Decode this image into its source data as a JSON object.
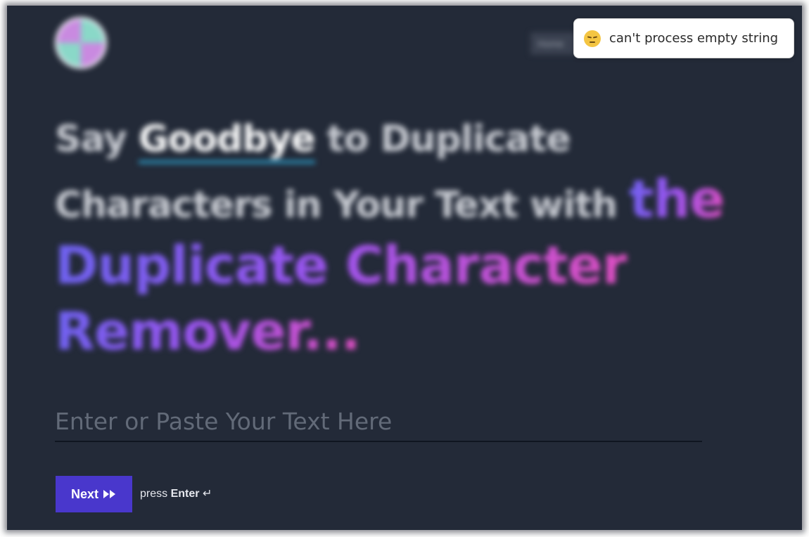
{
  "header": {
    "logo": "app-logo",
    "home_label": "Home"
  },
  "hero": {
    "line1_prefix": "Say ",
    "line1_highlight": "Goodbye",
    "line1_suffix": " to Duplicate",
    "line2": "Characters in Your Text with ",
    "brand_line1": "the",
    "brand_line2": "Duplicate Character",
    "brand_line3": "Remover...",
    "accent_colors": [
      "#6f63f2",
      "#9a55f0",
      "#e04fc2"
    ]
  },
  "form": {
    "input_placeholder": "Enter or Paste Your Text Here",
    "input_value": "",
    "next_label": "Next",
    "next_icon": "fast-forward-icon",
    "hint_prefix": "press ",
    "hint_key": "Enter",
    "hint_icon": "↵"
  },
  "toast": {
    "icon": "pensive-face-icon",
    "message": "can't process empty string"
  },
  "colors": {
    "background": "#232a38",
    "button": "#4937cc",
    "underline_accent": "#2b8fb8"
  }
}
